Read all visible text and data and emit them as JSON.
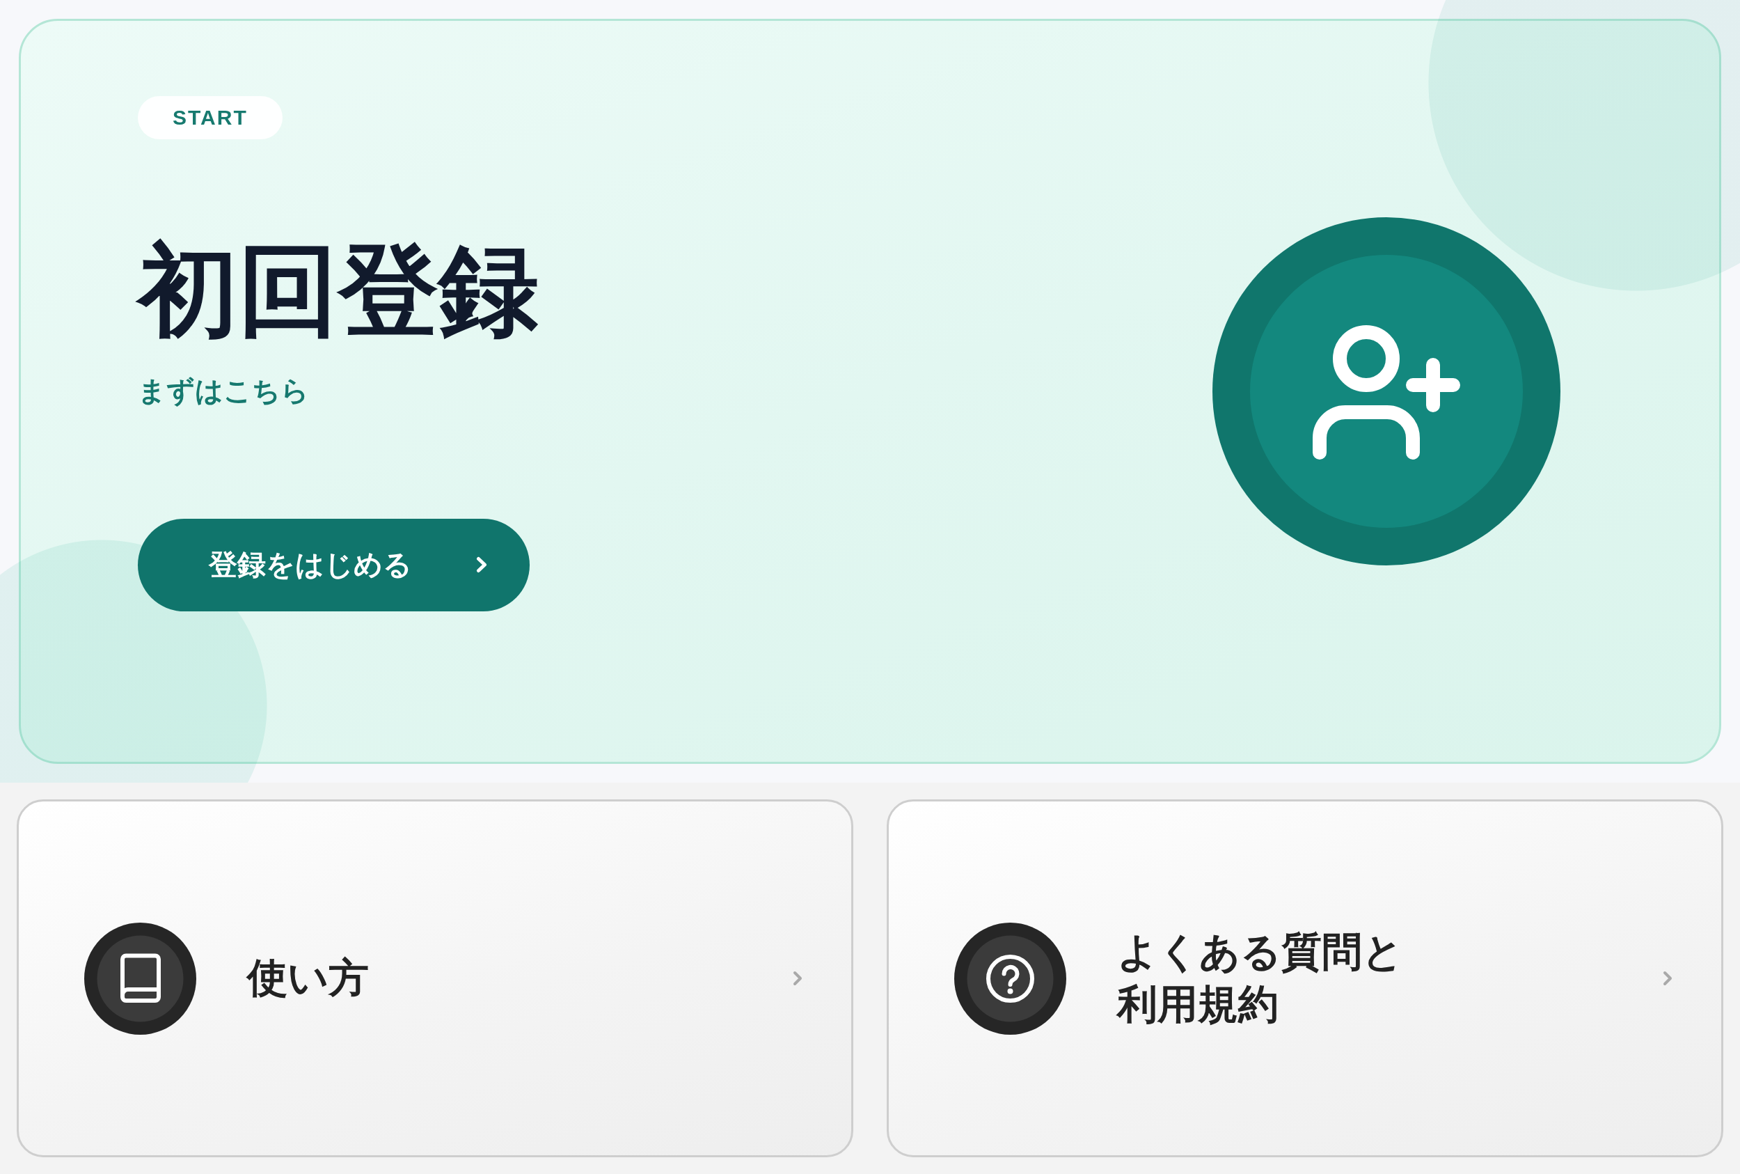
{
  "hero": {
    "badge": "START",
    "title": "初回登録",
    "subtitle": "まずはこちら",
    "button": {
      "label": "登録をはじめる"
    }
  },
  "cards": [
    {
      "kind": "guide",
      "label": "使い方"
    },
    {
      "kind": "help",
      "label": "よくある質問と利用規約"
    }
  ]
}
